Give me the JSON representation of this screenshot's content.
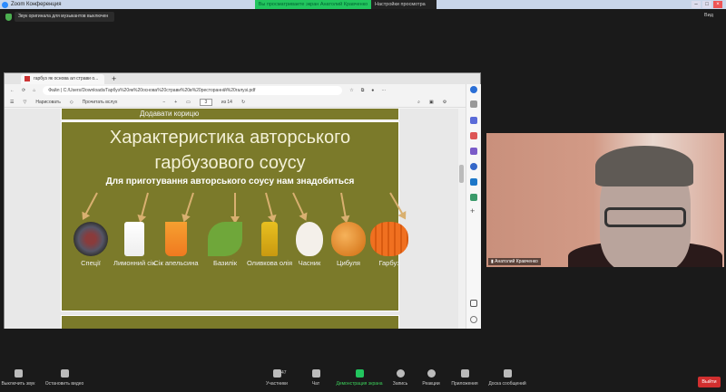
{
  "zoom": {
    "window_title": "Zoom Конференция",
    "banner": "Вы просматриваете экран Анатолий Кравченко",
    "view_options": "Настройки просмотра",
    "notice": "Звук оригинала для музыкантов выключен",
    "view": "Вид"
  },
  "browser": {
    "tab_title": "гарбуз як основа ал страви о...",
    "url": "C:/Users/Downloads/Гарбуз%20як%20основа%20страви%20в%20ресторанній%20галузі.pdf",
    "url_info": "Файл",
    "draw": "Нарисовать",
    "read_aloud": "Прочитать вслух",
    "page": "3",
    "page_total": "из 14"
  },
  "slide": {
    "prev_caption": "Додавати корицю",
    "title": "Характеристика авторського гарбузового соусу",
    "subtitle": "Для приготування авторського соусу нам знадобиться",
    "items": [
      {
        "label": "Спеції"
      },
      {
        "label": "Лимонний сік"
      },
      {
        "label": "Сік апельсина"
      },
      {
        "label": "Базилік"
      },
      {
        "label": "Оливкова олія"
      },
      {
        "label": "Часник"
      },
      {
        "label": "Цибуля"
      },
      {
        "label": "Гарбуз"
      }
    ]
  },
  "video": {
    "name": "Анатолий Кравченко"
  },
  "toolbar": {
    "mute": "Выключить звук",
    "video": "Остановить видео",
    "participants": "Участники",
    "participants_count": "47",
    "chat": "Чат",
    "share": "Демонстрация экрана",
    "record": "Запись",
    "reactions": "Реакции",
    "apps": "Приложения",
    "whiteboard": "Доска сообщений",
    "leave": "Выйти"
  }
}
